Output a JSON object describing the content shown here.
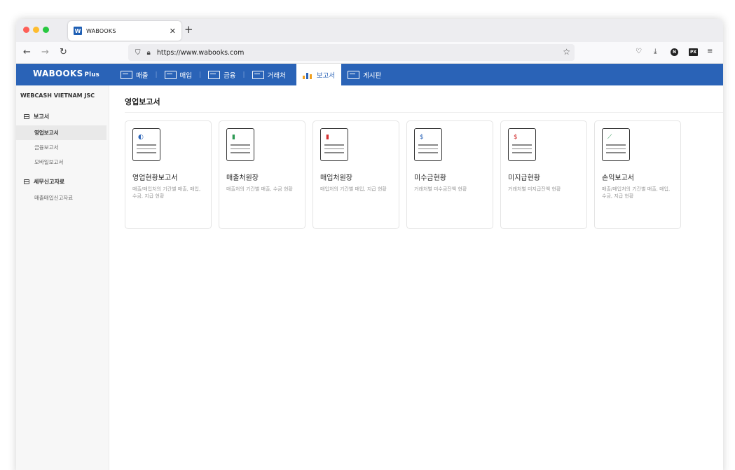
{
  "browser": {
    "tab_title": "WABOOKS",
    "favicon_letter": "W",
    "url": "https://www.wabooks.com",
    "extension_n": "N",
    "extension_px": "PX"
  },
  "app": {
    "brand": "WABOOKS",
    "brand_suffix": "Plus",
    "accent_color": "#2a63b7",
    "menu": [
      {
        "label": "매출",
        "icon": "sales-icon"
      },
      {
        "label": "매입",
        "icon": "purchase-icon"
      },
      {
        "label": "금융",
        "icon": "finance-icon"
      },
      {
        "label": "거래처",
        "icon": "client-icon"
      },
      {
        "label": "보고서",
        "icon": "report-icon",
        "active": true
      },
      {
        "label": "게시판",
        "icon": "board-icon"
      }
    ]
  },
  "sidebar": {
    "company": "WEBCASH VIETNAM JSC",
    "sections": [
      {
        "label": "보고서",
        "items": [
          "영업보고서",
          "금융보고서",
          "모바일보고서"
        ]
      },
      {
        "label": "세무신고자료",
        "items": [
          "매출매입신고자료"
        ]
      }
    ]
  },
  "main": {
    "title": "영업보고서",
    "cards": [
      {
        "title": "영업현황보고서",
        "desc": "매출/매입처의 기간별 매출, 매입, 수금, 지급 현황",
        "mark": "◐",
        "mark_color": "#2a63b7"
      },
      {
        "title": "매출처원장",
        "desc": "매출처의 기간별 매출, 수금 현황",
        "mark": "▮",
        "mark_color": "#2e9a55"
      },
      {
        "title": "매입처원장",
        "desc": "매입처의 기간별 매입, 지급 현황",
        "mark": "▮",
        "mark_color": "#d23030"
      },
      {
        "title": "미수금현황",
        "desc": "거래처별 미수금잔액 현황",
        "mark": "$",
        "mark_color": "#2a63b7"
      },
      {
        "title": "미지급현황",
        "desc": "거래처별 미지급잔액 현황",
        "mark": "$",
        "mark_color": "#d23030"
      },
      {
        "title": "손익보고서",
        "desc": "매출/매입처의 기간별 매출, 매입, 수금, 지급 현황",
        "mark": "⟋",
        "mark_color": "#2e9a55"
      }
    ]
  }
}
